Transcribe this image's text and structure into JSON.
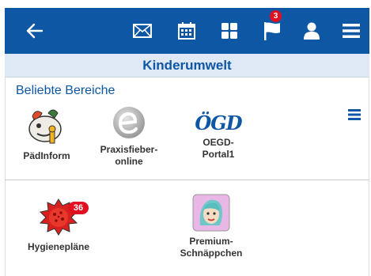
{
  "header": {
    "icons": [
      "back-arrow-icon",
      "mail-icon",
      "calendar-icon",
      "grid-icon",
      "flag-icon",
      "user-icon",
      "menu-icon"
    ],
    "flag_badge": "3",
    "colors": {
      "bar": "#0d57a4",
      "badge": "#e10f20"
    }
  },
  "title": "Kinderumwelt",
  "section": {
    "title": "Beliebte Bereiche",
    "tiles": [
      {
        "label_line1": "PädInform",
        "label_line2": ""
      },
      {
        "label_line1": "Praxisfieber-",
        "label_line2": "online"
      },
      {
        "label_line1": "OEGD-",
        "label_line2": "Portal1",
        "logo_text": "ÖGD"
      }
    ]
  },
  "section2": {
    "tiles": [
      {
        "label_line1": "Hygienepläne",
        "badge": "36"
      },
      {
        "label_line1": "Premium-",
        "label_line2": "Schnäppchen"
      }
    ]
  }
}
